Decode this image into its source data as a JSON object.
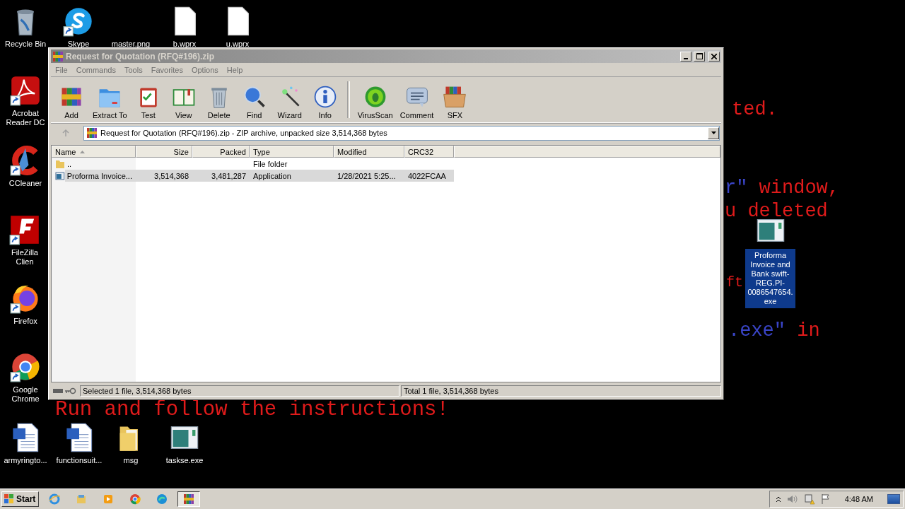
{
  "desktop_icons": [
    {
      "label": "Recycle Bin",
      "kind": "recycle-bin",
      "shortcut": false,
      "selected": false
    },
    {
      "label": "Skype",
      "kind": "skype",
      "shortcut": true,
      "selected": false
    },
    {
      "label": "master.png",
      "kind": "blank",
      "selected": false
    },
    {
      "label": "b.wprx",
      "kind": "file",
      "shortcut": false,
      "selected": false
    },
    {
      "label": "u.wprx",
      "kind": "file",
      "shortcut": false,
      "selected": false
    },
    {
      "label": "Acrobat Reader DC",
      "kind": "acrobat",
      "shortcut": true,
      "selected": false
    },
    {
      "label": "CCleaner",
      "kind": "ccleaner",
      "shortcut": true,
      "selected": false
    },
    {
      "label": "FileZilla Clien",
      "kind": "filezilla",
      "shortcut": true,
      "selected": false
    },
    {
      "label": "Firefox",
      "kind": "firefox",
      "shortcut": true,
      "selected": false
    },
    {
      "label": "Google Chrome",
      "kind": "chrome",
      "shortcut": true,
      "selected": false
    },
    {
      "label": "armyringto...",
      "kind": "word",
      "shortcut": false,
      "selected": false
    },
    {
      "label": "functionsuit...",
      "kind": "word",
      "shortcut": false,
      "selected": false
    },
    {
      "label": "msg",
      "kind": "folder",
      "shortcut": false,
      "selected": false
    },
    {
      "label": "taskse.exe",
      "kind": "exe",
      "shortcut": false,
      "selected": false
    },
    {
      "label": "Proforma Invoice and Bank swift-REG.PI-0086547654.exe",
      "kind": "exe",
      "shortcut": false,
      "selected": true
    }
  ],
  "background_text": [
    {
      "segments": [
        {
          "text": "ted.",
          "color": "#e01b1b"
        }
      ]
    },
    {
      "segments": [
        {
          "text": "r\"",
          "color": "#3a45c8"
        },
        {
          "text": " window,",
          "color": "#e01b1b"
        }
      ]
    },
    {
      "segments": [
        {
          "text": "u deleted",
          "color": "#e01b1b"
        }
      ]
    },
    {
      "segments": [
        {
          "text": "ft",
          "color": "#e01b1b"
        }
      ]
    },
    {
      "segments": [
        {
          "text": ".exe\"",
          "color": "#3a45c8"
        },
        {
          "text": " in",
          "color": "#e01b1b"
        }
      ]
    },
    {
      "segments": [
        {
          "text": "Run and follow the instructions!",
          "color": "#e01b1b"
        }
      ]
    }
  ],
  "window": {
    "title": "Request for Quotation (RFQ#196).zip",
    "active": false,
    "menu": [
      "File",
      "Commands",
      "Tools",
      "Favorites",
      "Options",
      "Help"
    ],
    "toolbar_groups": [
      [
        {
          "label": "Add",
          "kind": "add"
        },
        {
          "label": "Extract To",
          "kind": "extract"
        },
        {
          "label": "Test",
          "kind": "test"
        },
        {
          "label": "View",
          "kind": "view"
        },
        {
          "label": "Delete",
          "kind": "delete"
        },
        {
          "label": "Find",
          "kind": "find"
        },
        {
          "label": "Wizard",
          "kind": "wizard"
        },
        {
          "label": "Info",
          "kind": "info"
        }
      ],
      [
        {
          "label": "VirusScan",
          "kind": "virus"
        },
        {
          "label": "Comment",
          "kind": "comment"
        },
        {
          "label": "SFX",
          "kind": "sfx"
        }
      ]
    ],
    "address": "Request for Quotation (RFQ#196).zip - ZIP archive, unpacked size 3,514,368 bytes",
    "columns": [
      {
        "label": "Name",
        "sorted": true
      },
      {
        "label": "Size",
        "sorted": false
      },
      {
        "label": "Packed",
        "sorted": false
      },
      {
        "label": "Type",
        "sorted": false
      },
      {
        "label": "Modified",
        "sorted": false
      },
      {
        "label": "CRC32",
        "sorted": false
      }
    ],
    "rows": [
      {
        "kind": "folder",
        "selected": false,
        "cells": [
          "..",
          null,
          null,
          "File folder",
          null,
          null
        ]
      },
      {
        "kind": "app",
        "selected": true,
        "cells": [
          "Proforma Invoice...",
          "3,514,368",
          "3,481,287",
          "Application",
          "1/28/2021 5:25...",
          "4022FCAA"
        ]
      }
    ],
    "status_left": "Selected 1 file, 3,514,368 bytes",
    "status_right": "Total 1 file, 3,514,368 bytes"
  },
  "taskbar": {
    "start": "Start",
    "apps": [
      {
        "kind": "ie",
        "selected": false
      },
      {
        "kind": "explorer",
        "selected": false
      },
      {
        "kind": "media",
        "selected": false
      },
      {
        "kind": "chrome",
        "selected": false
      },
      {
        "kind": "edge",
        "selected": false
      },
      {
        "kind": "winrar",
        "selected": true
      }
    ],
    "time": "4:48 AM"
  }
}
